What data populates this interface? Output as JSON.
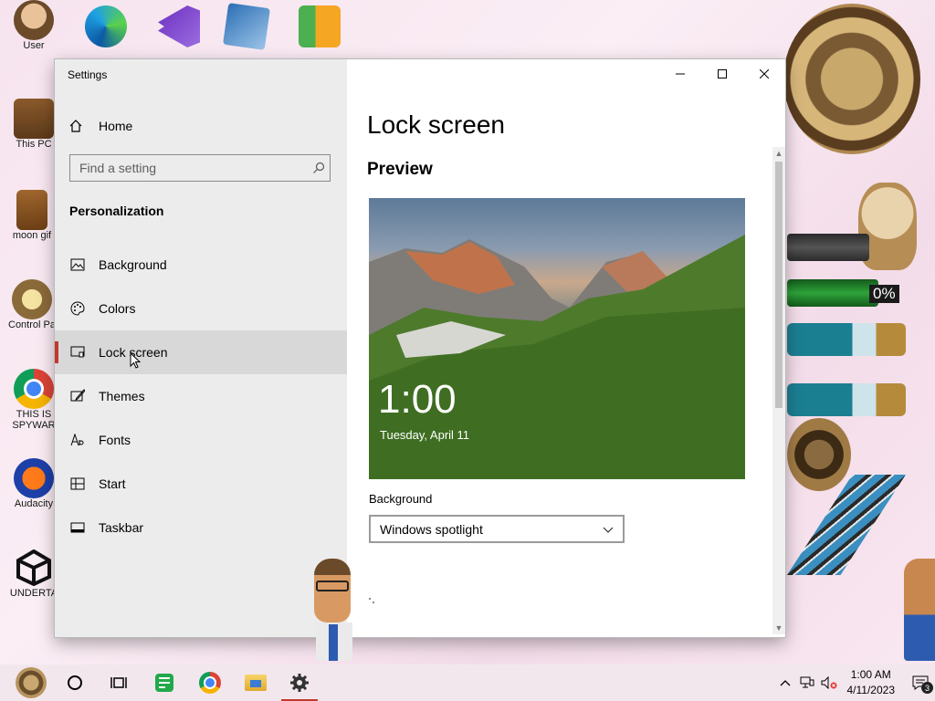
{
  "desktop": {
    "left_icons": [
      {
        "label": "User"
      },
      {
        "label": "This PC"
      },
      {
        "label": "moon gif"
      },
      {
        "label": "Control Pa"
      },
      {
        "label": "THIS IS\nSPYWAR"
      },
      {
        "label": "Audacity"
      },
      {
        "label": "UNDERTA"
      }
    ],
    "gauge_percent": "0%"
  },
  "window": {
    "title": "Settings",
    "nav": {
      "home_label": "Home",
      "search_placeholder": "Find a setting",
      "section": "Personalization",
      "items": [
        {
          "label": "Background",
          "icon": "picture-icon"
        },
        {
          "label": "Colors",
          "icon": "palette-icon"
        },
        {
          "label": "Lock screen",
          "icon": "lock-screen-icon",
          "active": true
        },
        {
          "label": "Themes",
          "icon": "brush-icon"
        },
        {
          "label": "Fonts",
          "icon": "font-icon"
        },
        {
          "label": "Start",
          "icon": "start-icon"
        },
        {
          "label": "Taskbar",
          "icon": "taskbar-icon"
        }
      ]
    },
    "content": {
      "title": "Lock screen",
      "preview_heading": "Preview",
      "preview_time": "1:00",
      "preview_date": "Tuesday, April 11",
      "background_label": "Background",
      "background_value": "Windows spotlight"
    }
  },
  "taskbar": {
    "time": "1:00 AM",
    "date": "4/11/2023",
    "notification_count": "3"
  },
  "colors": {
    "accent": "#c0392b",
    "nav_bg": "#ececec"
  }
}
